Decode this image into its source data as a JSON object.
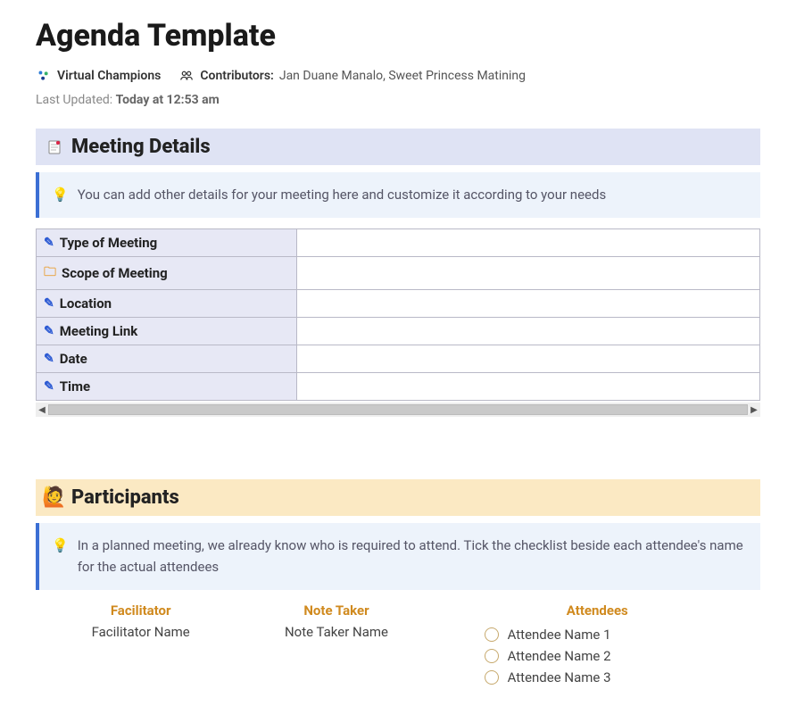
{
  "page": {
    "title": "Agenda Template"
  },
  "meta": {
    "org_name": "Virtual Champions",
    "contributors_label": "Contributors:",
    "contributors_names": "Jan Duane Manalo, Sweet Princess Matining",
    "last_updated_label": "Last Updated: ",
    "last_updated_value": "Today at 12:53 am"
  },
  "sections": {
    "meeting_details": {
      "title": "Meeting Details",
      "callout": "You can add other details for your meeting here and customize it according to your needs",
      "rows": [
        {
          "icon": "pencil",
          "label": "Type of Meeting",
          "value": ""
        },
        {
          "icon": "folder",
          "label": "Scope of Meeting",
          "value": ""
        },
        {
          "icon": "pencil",
          "label": "Location",
          "value": ""
        },
        {
          "icon": "pencil",
          "label": "Meeting Link",
          "value": ""
        },
        {
          "icon": "pencil",
          "label": "Date",
          "value": ""
        },
        {
          "icon": "pencil",
          "label": "Time",
          "value": ""
        }
      ]
    },
    "participants": {
      "title": "Participants",
      "callout": "In a planned meeting, we already know who is required to attend. Tick the checklist beside each attendee's name for the actual attendees",
      "facilitator_header": "Facilitator",
      "facilitator_value": "Facilitator Name",
      "notetaker_header": "Note Taker",
      "notetaker_value": "Note Taker Name",
      "attendees_header": "Attendees",
      "attendees": [
        "Attendee Name 1",
        "Attendee Name 2",
        "Attendee Name 3"
      ]
    }
  }
}
